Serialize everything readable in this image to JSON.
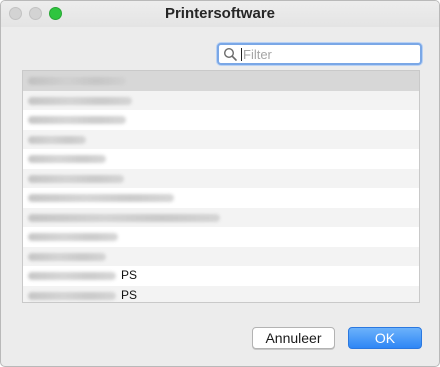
{
  "window": {
    "title": "Printersoftware"
  },
  "search": {
    "placeholder": "Filter",
    "value": ""
  },
  "list": {
    "items": [
      {
        "suffix": "",
        "selected": true,
        "blur_width": 98
      },
      {
        "suffix": "",
        "selected": false,
        "blur_width": 104
      },
      {
        "suffix": "",
        "selected": false,
        "blur_width": 98
      },
      {
        "suffix": "",
        "selected": false,
        "blur_width": 58
      },
      {
        "suffix": "",
        "selected": false,
        "blur_width": 78
      },
      {
        "suffix": "",
        "selected": false,
        "blur_width": 96
      },
      {
        "suffix": "",
        "selected": false,
        "blur_width": 146
      },
      {
        "suffix": "",
        "selected": false,
        "blur_width": 192
      },
      {
        "suffix": "",
        "selected": false,
        "blur_width": 90
      },
      {
        "suffix": "",
        "selected": false,
        "blur_width": 78
      },
      {
        "suffix": "PS",
        "selected": false,
        "blur_width": 88
      },
      {
        "suffix": "PS",
        "selected": false,
        "blur_width": 88
      }
    ]
  },
  "buttons": {
    "cancel_label": "Annuleer",
    "ok_label": "OK"
  },
  "icons": {
    "search": "magnifying-glass-icon",
    "close": "close-traffic-light-icon",
    "minimize": "minimize-traffic-light-icon",
    "zoom": "zoom-traffic-light-icon"
  },
  "colors": {
    "accent": "#2e86f5",
    "zoom_green": "#2fc53f",
    "focus_ring": "#7aa7e6"
  }
}
